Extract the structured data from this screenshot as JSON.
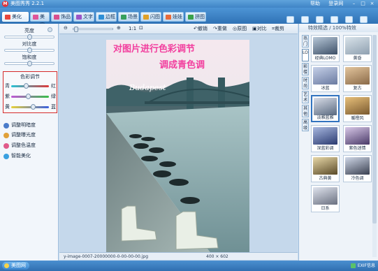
{
  "window": {
    "title": "美图秀秀 2.2.1",
    "links": [
      "帮助",
      "登录网"
    ],
    "controls": [
      "–",
      "□",
      "×"
    ]
  },
  "toolbar": {
    "tabs": [
      {
        "label": "美化",
        "color": "#e8463c"
      },
      {
        "label": "美容",
        "color": "#e0569a"
      },
      {
        "label": "饰品",
        "color": "#d94f8e"
      },
      {
        "label": "文字",
        "color": "#9b55c7"
      },
      {
        "label": "边框",
        "color": "#2e8fd6"
      },
      {
        "label": "场景",
        "color": "#36a05c"
      },
      {
        "label": "闪图",
        "color": "#e0a127"
      },
      {
        "label": "娃娃",
        "color": "#e86b3a"
      },
      {
        "label": "拼图",
        "color": "#3aa24a"
      }
    ],
    "right_tools": [
      "打开",
      "保存",
      "分享",
      "预览",
      "尺寸",
      "旋转"
    ]
  },
  "left_panel": {
    "sliders": [
      {
        "label": "亮度",
        "value": 0.5
      },
      {
        "label": "对比度",
        "value": 0.5
      },
      {
        "label": "饱和度",
        "value": 0.5
      }
    ],
    "color_balance": {
      "title": "色彩调节",
      "rows": [
        {
          "left": "青",
          "right": "红",
          "value": 0.38,
          "gradient_from": "#27c4d6",
          "gradient_to": "#e03838"
        },
        {
          "left": "紫",
          "right": "绿",
          "value": 0.45,
          "gradient_from": "#c058d6",
          "gradient_to": "#38c048"
        },
        {
          "left": "黄",
          "right": "蓝",
          "value": 0.6,
          "gradient_from": "#e8d238",
          "gradient_to": "#3a5fe0"
        }
      ]
    },
    "effects": [
      {
        "label": "调整明暗度",
        "color": "#4a7bc9"
      },
      {
        "label": "调整曝光度",
        "color": "#e0a03a"
      },
      {
        "label": "调整色温度",
        "color": "#e05a8a"
      },
      {
        "label": "智能美化",
        "color": "#3aa0e0"
      }
    ]
  },
  "canvas_toolbar": {
    "zoom_label": "1:1",
    "items": [
      "撤销",
      "重做",
      "原图",
      "对比",
      "裁剪"
    ]
  },
  "image": {
    "overlay_line1": "对图片进行色彩调节",
    "overlay_line2": "调成青色调",
    "overlay_color": "#f23e9e",
    "city_text": "Budapest"
  },
  "status": {
    "filename": "y-image-0007-20000000-0-00-00-00.jpg",
    "size": "400 × 602"
  },
  "right_panel": {
    "header": "特效精选 / 100%特效",
    "vtabs": [
      "热门",
      "LOMO",
      "影楼",
      "时尚",
      "艺术",
      "其他",
      "高级"
    ],
    "thumbs": [
      {
        "label": "经典LOMO",
        "c1": "#b8c8d8",
        "c2": "#3d5068"
      },
      {
        "label": "黄昏",
        "c1": "#d9e3ea",
        "c2": "#8fa0b0"
      },
      {
        "label": "冰蓝",
        "c1": "#c5d0e8",
        "c2": "#6a7aa0"
      },
      {
        "label": "复古",
        "c1": "#e3c59d",
        "c2": "#8a6a48"
      },
      {
        "label": "淡雅蓝雅",
        "c1": "#d9dde8",
        "c2": "#5a6a80"
      },
      {
        "label": "暖橙风",
        "c1": "#e8c07a",
        "c2": "#7a5a30"
      },
      {
        "label": "深蓝彩调",
        "c1": "#a8b8e0",
        "c2": "#2a3a70"
      },
      {
        "label": "紫色迷情",
        "c1": "#d8c8e8",
        "c2": "#4a3a68"
      },
      {
        "label": "古典黄",
        "c1": "#e8d8a8",
        "c2": "#5a4a28"
      },
      {
        "label": "冷色调",
        "c1": "#d0d8e8",
        "c2": "#3a4050"
      },
      {
        "label": "日系",
        "c1": "#e0e4ee",
        "c2": "#6a7080"
      }
    ]
  },
  "bottom": {
    "start": "美图网",
    "right": "EXIF信息"
  }
}
